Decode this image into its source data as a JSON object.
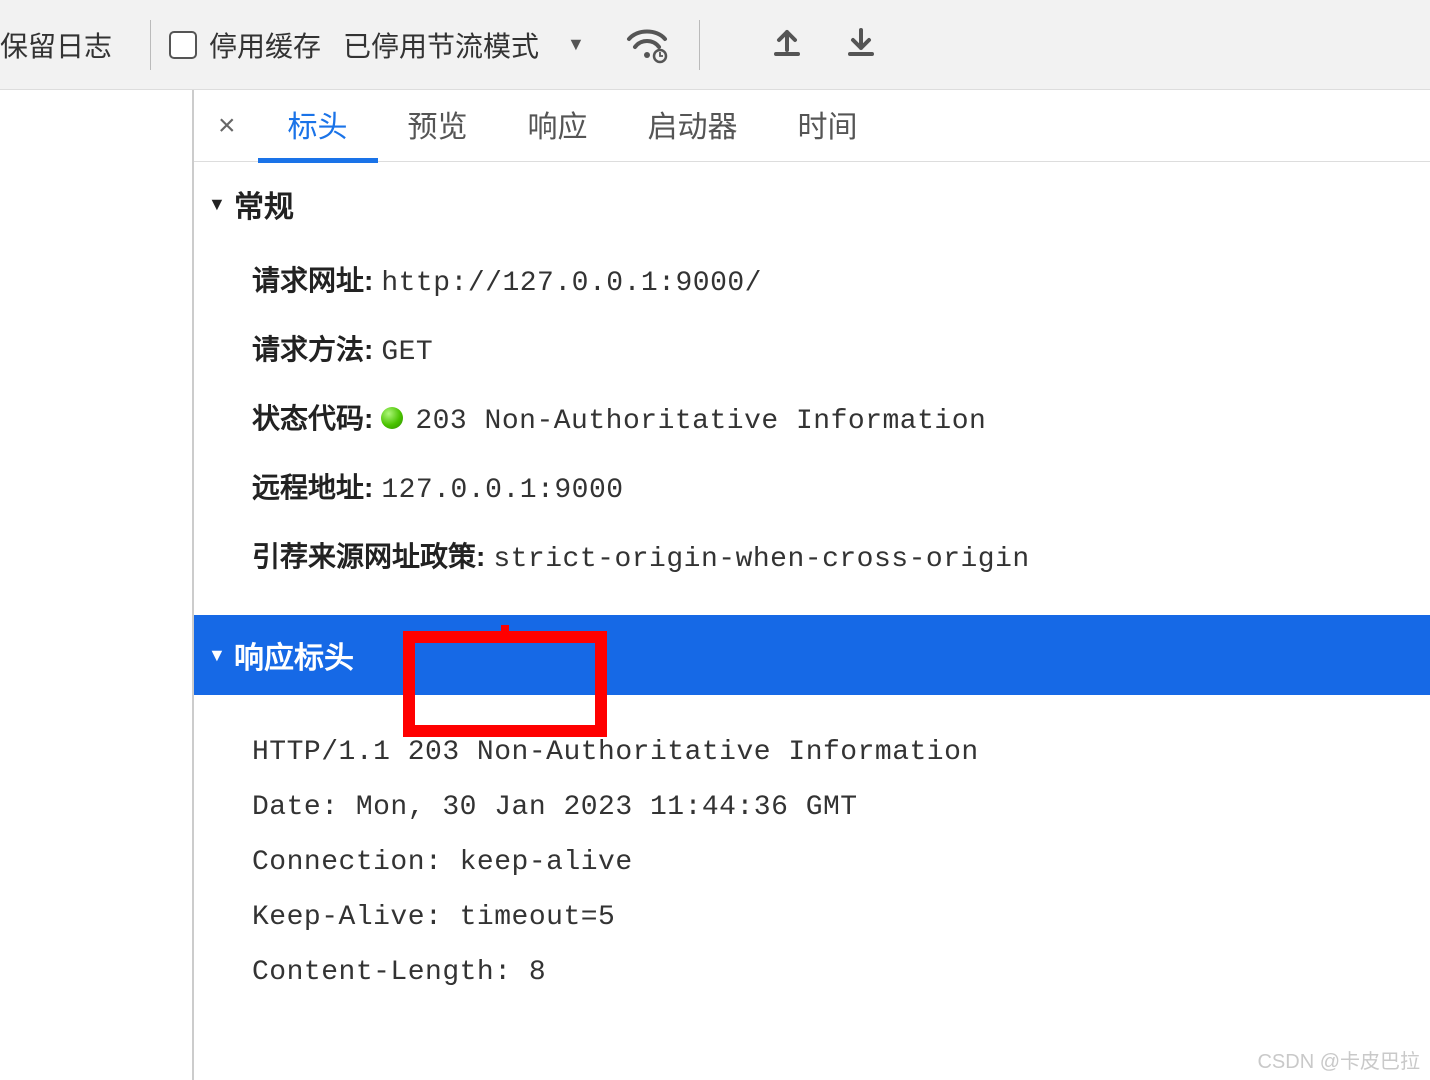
{
  "toolbar": {
    "preserve_log_label": "保留日志",
    "disable_cache_label": "停用缓存",
    "throttling_label": "已停用节流模式"
  },
  "tabs": {
    "items": [
      {
        "label": "标头",
        "active": true
      },
      {
        "label": "预览",
        "active": false
      },
      {
        "label": "响应",
        "active": false
      },
      {
        "label": "启动器",
        "active": false
      },
      {
        "label": "时间",
        "active": false
      }
    ]
  },
  "sections": {
    "general": {
      "title": "常规",
      "rows": {
        "request_url": {
          "key": "请求网址:",
          "value": "http://127.0.0.1:9000/"
        },
        "request_method": {
          "key": "请求方法:",
          "value": "GET"
        },
        "status_code": {
          "key": "状态代码:",
          "value": "203 Non-Authoritative Information"
        },
        "remote_address": {
          "key": "远程地址:",
          "value": "127.0.0.1:9000"
        },
        "referrer_policy": {
          "key": "引荐来源网址政策:",
          "value": "strict-origin-when-cross-origin"
        }
      }
    },
    "response_headers": {
      "title": "响应标头",
      "raw": [
        "HTTP/1.1 203 Non-Authoritative Information",
        "Date: Mon, 30 Jan 2023 11:44:36 GMT",
        "Connection: keep-alive",
        "Keep-Alive: timeout=5",
        "Content-Length: 8"
      ]
    }
  },
  "watermark": "CSDN @卡皮巴拉"
}
